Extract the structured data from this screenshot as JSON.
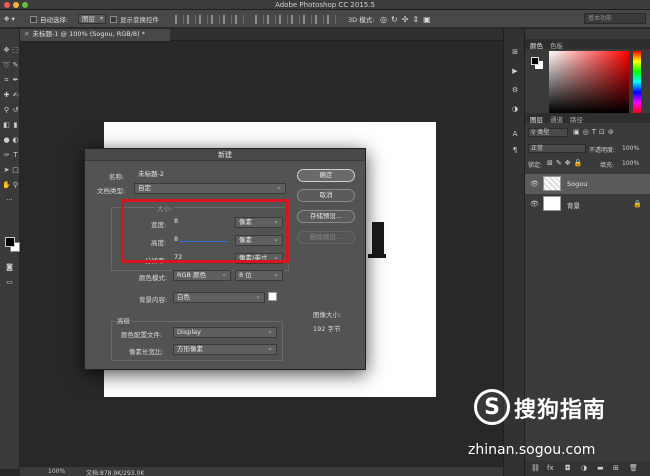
{
  "app": {
    "title": "Adobe Photoshop CC 2015.5"
  },
  "options_bar": {
    "auto_select_label": "自动选择:",
    "auto_select_value": "图层",
    "transform_label": "显示变换控件",
    "mode_3d_label": "3D 模式:",
    "search_placeholder": "基本功能"
  },
  "document": {
    "tab_title": "未标题-1 @ 100% (Sogou, RGB/8) *",
    "zoom": "100%",
    "doc_info": "文档:878.9K/293.0K"
  },
  "color_panel": {
    "tabs": [
      "颜色",
      "色板"
    ],
    "active": "颜色"
  },
  "layers_panel": {
    "tabs": [
      "图层",
      "通道",
      "路径"
    ],
    "kind_filter": "类型",
    "blend_mode": "正常",
    "opacity_label": "不透明度:",
    "opacity_value": "100%",
    "lock_label": "锁定:",
    "fill_label": "填充:",
    "fill_value": "100%",
    "layers": [
      {
        "name": "Sogou"
      },
      {
        "name": "背景"
      }
    ]
  },
  "dialog": {
    "title": "新建",
    "name_label": "名称:",
    "name_value": "未标题-2",
    "doctype_label": "文档类型:",
    "doctype_value": "自定",
    "size_label": "大小:",
    "width_label": "宽度:",
    "width_value": "8",
    "width_unit": "像素",
    "height_label": "高度:",
    "height_value": "8",
    "height_unit": "像素",
    "resolution_label": "分辨率:",
    "resolution_value": "72",
    "resolution_unit": "像素/英寸",
    "colormode_label": "颜色模式:",
    "colormode_value": "RGB 颜色",
    "bitdepth_value": "8 位",
    "bgcontent_label": "背景内容:",
    "bgcontent_value": "白色",
    "advanced_label": "高级",
    "profile_label": "颜色配置文件:",
    "profile_value": "Display",
    "aspect_label": "像素长宽比:",
    "aspect_value": "方形像素",
    "image_size_label": "图像大小:",
    "image_size_value": "192 字节",
    "ok_button": "确定",
    "cancel_button": "取消",
    "save_preset_button": "存储预设...",
    "delete_preset_button": "删除预设..."
  },
  "watermark": {
    "brand": "搜狗指南",
    "url": "zhinan.sogou.com"
  },
  "colors": {
    "highlight": "#d9141d",
    "accent_blue": "#2f6fd6"
  }
}
